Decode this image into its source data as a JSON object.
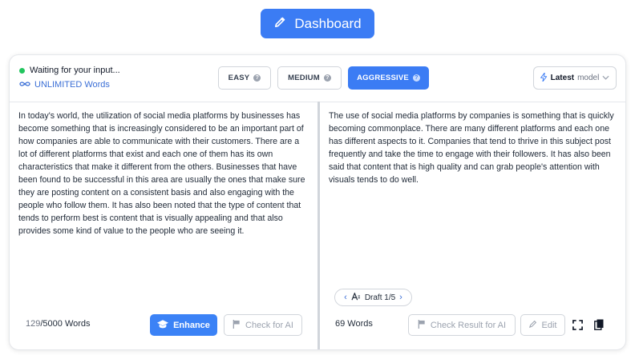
{
  "header": {
    "dashboard_label": "Dashboard"
  },
  "status": {
    "waiting_text": "Waiting for your input...",
    "unlimited_text": "UNLIMITED Words"
  },
  "modes": [
    {
      "label": "EASY",
      "active": false
    },
    {
      "label": "MEDIUM",
      "active": false
    },
    {
      "label": "AGGRESSIVE",
      "active": true
    }
  ],
  "model": {
    "latest": "Latest",
    "model": "model"
  },
  "input": {
    "text": "In today's world, the utilization of social media platforms by businesses has become something that is increasingly considered to be an important part of how companies are able to communicate with their customers. There are a lot of different platforms that exist and each one of them has its own characteristics that make it different from the others. Businesses that have been found to be successful in this area are usually the ones that make sure they are posting content on a consistent basis and also engaging with the people who follow them. It has also been noted that the type of content that tends to perform best is content that is visually appealing and that also provides some kind of value to the people who are seeing it.",
    "word_count": "129",
    "word_limit": "/5000 Words",
    "enhance_label": "Enhance",
    "check_ai_label": "Check for AI"
  },
  "output": {
    "text": "The use of social media platforms by companies is something that is quickly becoming commonplace. There are many different platforms and each one has different aspects to it. Companies that tend to thrive in this subject post frequently and take the time to engage with their followers. It has also been said that content that is high quality and can grab people's attention with visuals tends to do well.",
    "draft_label": "Draft 1/5",
    "word_count_label": "69 Words",
    "check_result_label": "Check Result for AI",
    "edit_label": "Edit"
  },
  "colors": {
    "accent": "#3b7cf4",
    "status_green": "#22c55e",
    "link_blue": "#3b6fd6"
  }
}
